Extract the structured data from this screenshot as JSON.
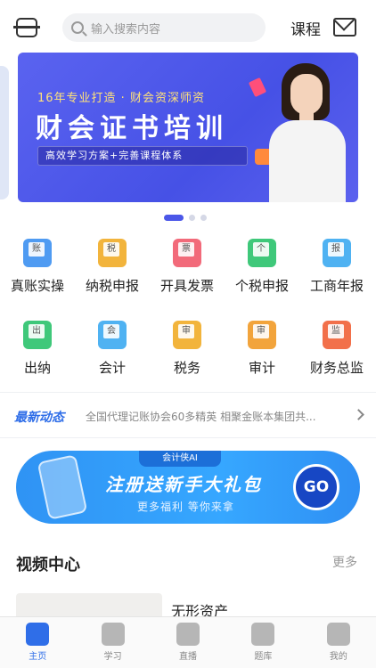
{
  "header": {
    "search_placeholder": "输入搜索内容",
    "course_label": "课程"
  },
  "banner": {
    "subtitle": "16年专业打造 · 财会资深师资",
    "title": "财会证书培训",
    "tagline": "高效学习方案+完善课程体系",
    "pages": 3,
    "active_page": 1
  },
  "grid": {
    "items": [
      {
        "label": "真账实操",
        "icon_text": "账",
        "color": "#4f9bf2"
      },
      {
        "label": "纳税申报",
        "icon_text": "税",
        "color": "#f2b43c"
      },
      {
        "label": "开具发票",
        "icon_text": "票",
        "color": "#f26a7a"
      },
      {
        "label": "个税申报",
        "icon_text": "个",
        "color": "#3fc87a"
      },
      {
        "label": "工商年报",
        "icon_text": "报",
        "color": "#4fb2f2"
      },
      {
        "label": "出纳",
        "icon_text": "出",
        "color": "#3fc87a"
      },
      {
        "label": "会计",
        "icon_text": "会",
        "color": "#4fb2f2"
      },
      {
        "label": "税务",
        "icon_text": "审",
        "color": "#f2b43c"
      },
      {
        "label": "审计",
        "icon_text": "审",
        "color": "#f2a43c"
      },
      {
        "label": "财务总监",
        "icon_text": "监",
        "color": "#f2704a"
      }
    ]
  },
  "news": {
    "logo": "最新动态",
    "text": "全国代理记账协会60多精英 相聚金账本集团共..."
  },
  "promo": {
    "tag": "会计侠AI",
    "main": "注册送新手大礼包",
    "sub": "更多福利 等你来拿",
    "go": "GO"
  },
  "video_section": {
    "title": "视频中心",
    "more": "更多",
    "first_item_title": "无形资产"
  },
  "tabbar": {
    "tabs": [
      {
        "label": "主页",
        "icon": "home-icon",
        "active": true
      },
      {
        "label": "学习",
        "icon": "book-icon",
        "active": false
      },
      {
        "label": "直播",
        "icon": "live-icon",
        "active": false
      },
      {
        "label": "题库",
        "icon": "grid-icon",
        "active": false
      },
      {
        "label": "我的",
        "icon": "user-icon",
        "active": false
      }
    ]
  }
}
